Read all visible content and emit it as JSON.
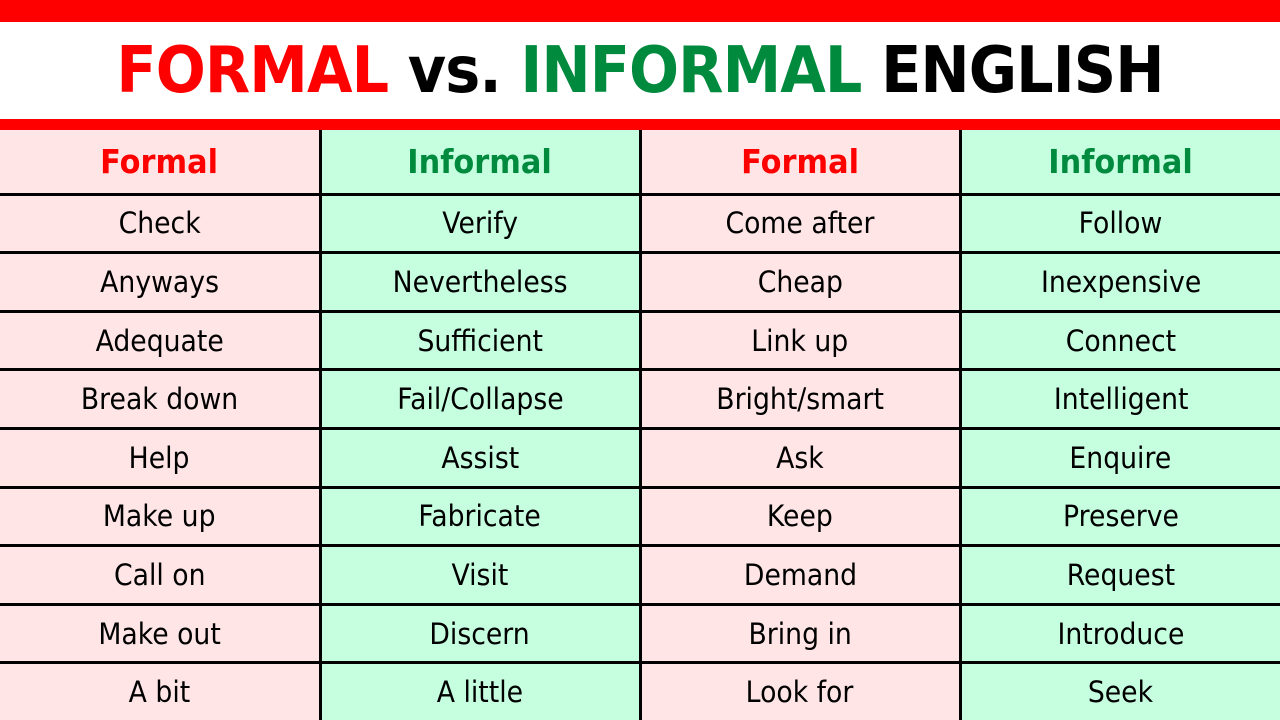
{
  "title": {
    "part1": "FORMAL",
    "part2": "vs.",
    "part3": "INFORMAL",
    "part4": "ENGLISH"
  },
  "colors": {
    "formal_accent": "#FF0000",
    "informal_accent": "#008A3E",
    "formal_bg": "#FFE5E5",
    "informal_bg": "#C6FFE0",
    "bar": "#FF0000"
  },
  "table": {
    "headers": [
      "Formal",
      "Informal",
      "Formal",
      "Informal"
    ],
    "rows": [
      [
        "Check",
        "Verify",
        "Come after",
        "Follow"
      ],
      [
        "Anyways",
        "Nevertheless",
        "Cheap",
        "Inexpensive"
      ],
      [
        "Adequate",
        "Sufficient",
        "Link up",
        "Connect"
      ],
      [
        "Break down",
        "Fail/Collapse",
        "Bright/smart",
        "Intelligent"
      ],
      [
        "Help",
        "Assist",
        "Ask",
        "Enquire"
      ],
      [
        "Make up",
        "Fabricate",
        "Keep",
        "Preserve"
      ],
      [
        "Call on",
        "Visit",
        "Demand",
        "Request"
      ],
      [
        "Make out",
        "Discern",
        "Bring in",
        "Introduce"
      ],
      [
        "A bit",
        "A little",
        "Look for",
        "Seek"
      ]
    ]
  }
}
